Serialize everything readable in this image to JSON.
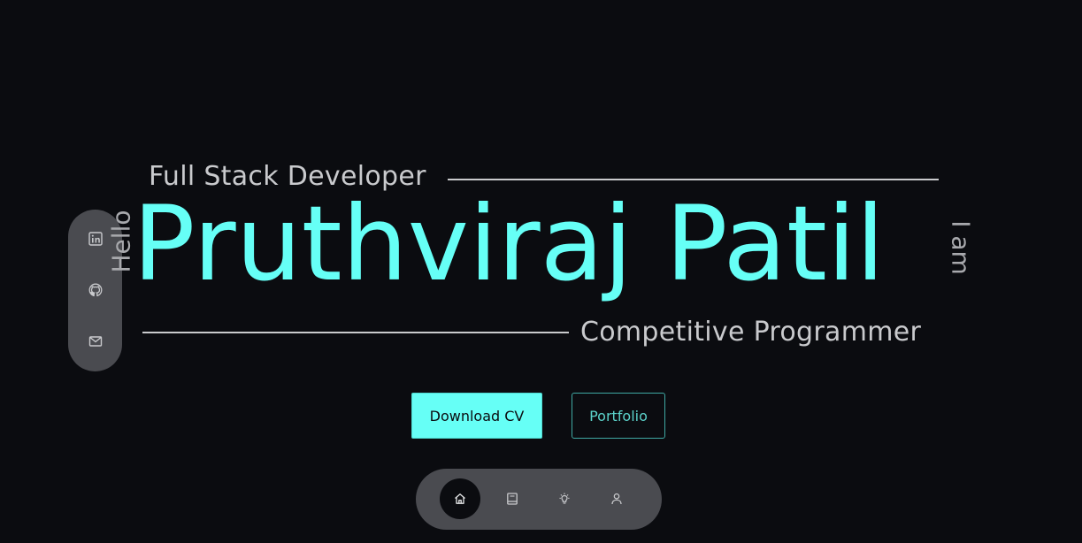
{
  "hero": {
    "greeting": "Hello",
    "intro": "I am",
    "name": "Pruthviraj Patil",
    "role_primary": "Full Stack Developer",
    "role_secondary": "Competitive Programmer"
  },
  "actions": {
    "download_cv_label": "Download CV",
    "portfolio_label": "Portfolio"
  },
  "social": {
    "items": [
      {
        "icon": "linkedin-icon"
      },
      {
        "icon": "github-icon"
      },
      {
        "icon": "mail-icon"
      }
    ]
  },
  "nav": {
    "items": [
      {
        "icon": "home-icon",
        "active": true
      },
      {
        "icon": "book-icon",
        "active": false
      },
      {
        "icon": "lightbulb-icon",
        "active": false
      },
      {
        "icon": "user-icon",
        "active": false
      }
    ]
  },
  "colors": {
    "background": "#0b0c10",
    "accent": "#66fff6",
    "text_muted": "#c9cacd",
    "panel": "#4a4b50"
  }
}
